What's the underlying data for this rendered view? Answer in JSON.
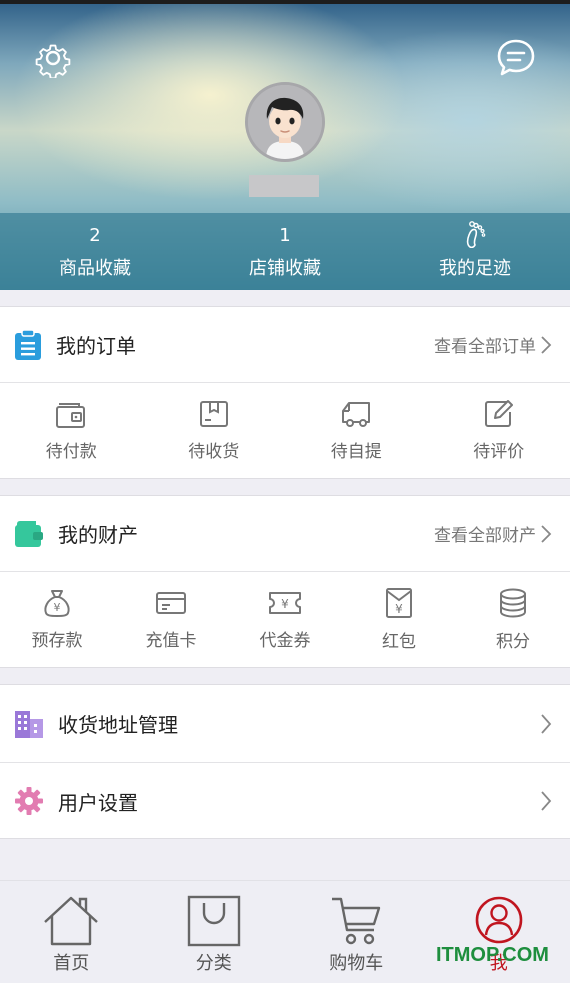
{
  "header": {
    "settings_icon": "gear-icon",
    "message_icon": "chat-bubble-icon",
    "stats": [
      {
        "count": "2",
        "label": "商品收藏"
      },
      {
        "count": "1",
        "label": "店铺收藏"
      },
      {
        "count": "",
        "label": "我的足迹",
        "icon": "footprint-icon"
      }
    ]
  },
  "orders": {
    "title": "我的订单",
    "link": "查看全部订单",
    "items": [
      {
        "label": "待付款",
        "icon": "wallet-icon"
      },
      {
        "label": "待收货",
        "icon": "package-icon"
      },
      {
        "label": "待自提",
        "icon": "truck-icon"
      },
      {
        "label": "待评价",
        "icon": "edit-icon"
      }
    ]
  },
  "assets": {
    "title": "我的财产",
    "link": "查看全部财产",
    "items": [
      {
        "label": "预存款",
        "icon": "money-bag-icon"
      },
      {
        "label": "充值卡",
        "icon": "card-icon"
      },
      {
        "label": "代金券",
        "icon": "voucher-icon"
      },
      {
        "label": "红包",
        "icon": "red-envelope-icon"
      },
      {
        "label": "积分",
        "icon": "coins-icon"
      }
    ]
  },
  "menu": [
    {
      "label": "收货地址管理",
      "icon": "building-icon"
    },
    {
      "label": "用户设置",
      "icon": "gear-icon"
    }
  ],
  "tabbar": [
    {
      "label": "首页",
      "icon": "home-icon"
    },
    {
      "label": "分类",
      "icon": "shopping-bag-icon"
    },
    {
      "label": "购物车",
      "icon": "cart-icon"
    },
    {
      "label": "我",
      "icon": "user-icon",
      "active": true
    }
  ],
  "watermark": "ITMOP.COM",
  "colors": {
    "accent_red": "#c0151f",
    "orders_icon": "#2a9ddd",
    "assets_icon": "#35c79c",
    "address_icon": "#9a78d8",
    "settings_icon": "#e27cb1",
    "watermark": "#1e8e3e"
  }
}
